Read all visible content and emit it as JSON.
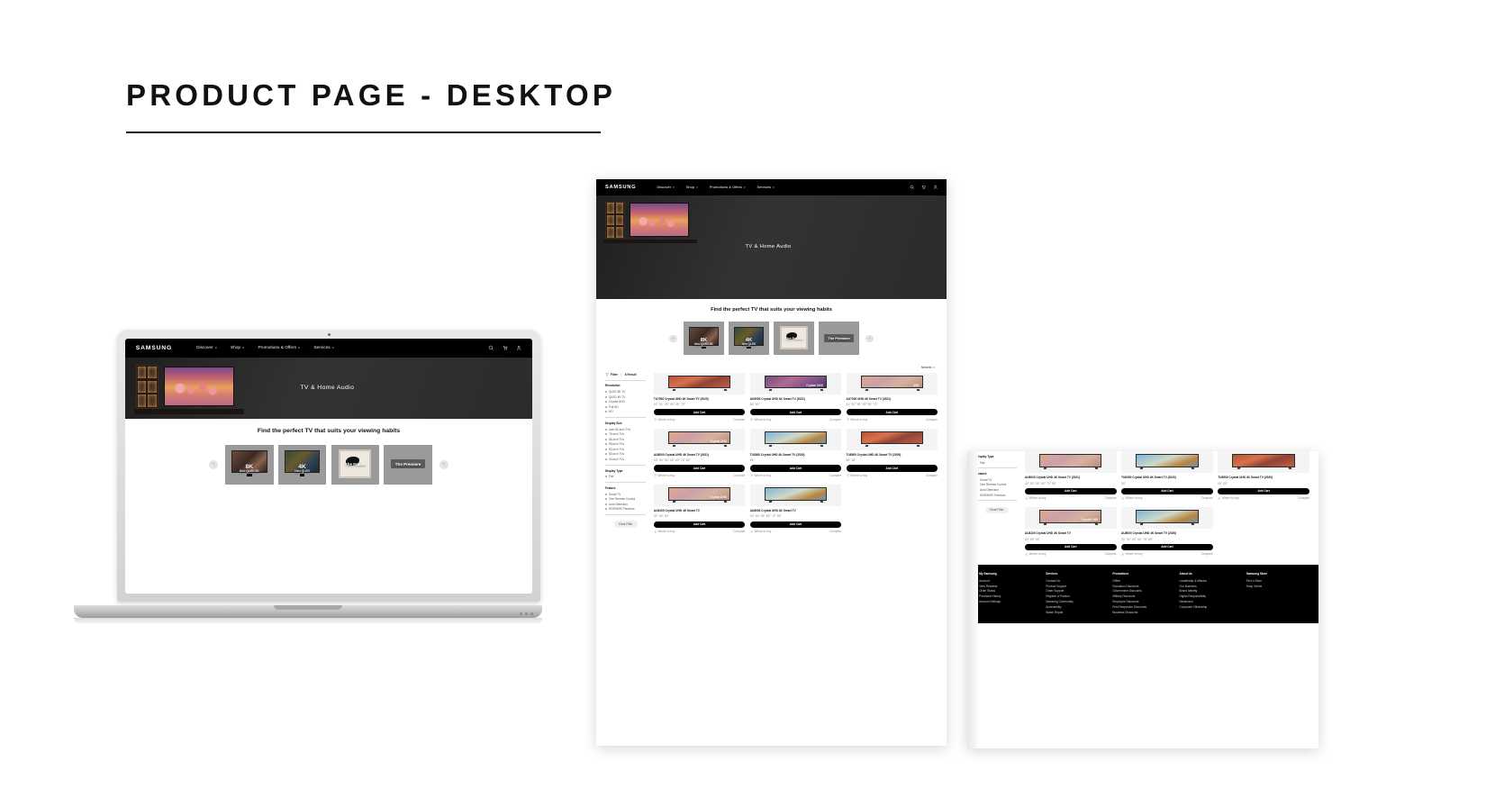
{
  "page": {
    "title": "PRODUCT PAGE - DESKTOP"
  },
  "brand": {
    "logo": "SAMSUNG"
  },
  "nav": {
    "items": [
      {
        "label": "Discover",
        "caret": "v"
      },
      {
        "label": "Shop",
        "caret": "v"
      },
      {
        "label": "Promotions & Offers",
        "caret": "v"
      },
      {
        "label": "Services",
        "caret": "v"
      }
    ],
    "icons": [
      {
        "name": "search-icon",
        "glyph": "search"
      },
      {
        "name": "cart-icon",
        "glyph": "cart"
      },
      {
        "name": "account-icon",
        "glyph": "person"
      }
    ]
  },
  "hero": {
    "title": "TV & Home Audio"
  },
  "finder": {
    "heading": "Find the perfect TV that suits your viewing habits",
    "prev_label": "‹",
    "next_label": "›",
    "tiles": [
      {
        "label": "8K",
        "sublabel": "Neo QLED 8K"
      },
      {
        "label": "4K",
        "sublabel": "Neo QLED"
      },
      {
        "label": "The Frame",
        "sublabel": ""
      },
      {
        "label": "The Premiere",
        "sublabel": ""
      }
    ]
  },
  "sort": {
    "label": "Newest",
    "caret": "v"
  },
  "filter": {
    "title": "Filter",
    "divider": "|",
    "result_count": "8 Result",
    "clear_label": "Clear Filter",
    "groups": [
      {
        "title": "Resolution",
        "options": [
          "QLED 8K TV",
          "QLED 4K TV",
          "Crystal UHD",
          "Full HD",
          "HD"
        ]
      },
      {
        "title": "Display Size",
        "options": [
          "over 82-inch TVs",
          "75-inch TVs",
          "65-inch TVs",
          "55-inch TVs",
          "50-inch TVs",
          "50-inch TVs",
          "43-inch TVs"
        ]
      },
      {
        "title": "Display Type",
        "options": [
          "Flat"
        ]
      },
      {
        "title": "Feature",
        "options": [
          "Smart TV",
          "One Remote Control",
          "Auto Detection",
          "HDR/HDR Premium"
        ]
      }
    ]
  },
  "product_labels": {
    "add_cart": "Add Cart",
    "where_to_buy": "Where to buy",
    "compare": "Compare"
  },
  "products_mid": [
    {
      "name": "TU7000 Crystal UHD 4K Smart TV (2020)",
      "sizes": "43\"  50\"  55\"  58\"  65\"  75\"",
      "badge": "",
      "tone": "warm"
    },
    {
      "name": "AU9000 Crystal UHD 4K Smart TV (2021)",
      "sizes": "55\"  65\"",
      "badge": "Crystal UHD",
      "tone": "violet"
    },
    {
      "name": "AU7000 UHD 4K Smart TV (2021)",
      "sizes": "43\"  50\"  55\"  58\"  65\"  70\"",
      "badge": "UHD",
      "tone": "peach"
    },
    {
      "name": "AU8000 Crystal UHD 4K Smart TV (2021)",
      "sizes": "43\"  50\"  55\"  60\"  65\"  75\"  85\"",
      "badge": "Crystal UHD",
      "tone": "peach"
    },
    {
      "name": "TU8300 Crystal UHD 4K Smart TV (2020)",
      "sizes": "55\"",
      "badge": "",
      "tone": "sky"
    },
    {
      "name": "TU8500 Crystal UHD 4K Smart TV (2020)",
      "sizes": "55\"  65\"",
      "badge": "",
      "tone": "warm"
    },
    {
      "name": "AU8100 Crystal UHD 4K Smart TV",
      "sizes": "50\"  55\"  65\"",
      "badge": "Crystal UHD",
      "tone": "peach"
    },
    {
      "name": "AU8000 Crystal UHD 4K Smart TV",
      "sizes": "43\"  50\"  55\"  65\"  75\"  85\"",
      "badge": "",
      "tone": "sky"
    }
  ],
  "products_right": [
    {
      "name": "AU8000 Crystal UHD 4K Smart TV (2021)",
      "sizes": "43\"  50\"  55\"  60\"  75\"  85\"",
      "badge": "",
      "tone": "peach"
    },
    {
      "name": "TU8300 Crystal UHD 4K Smart TV (2020)",
      "sizes": "55\"",
      "badge": "",
      "tone": "sky"
    },
    {
      "name": "TU8500 Crystal UHD 4K Smart TV (2020)",
      "sizes": "55\"  65\"",
      "badge": "",
      "tone": "warm"
    },
    {
      "name": "AU8100 Crystal UHD 4K Smart TV",
      "sizes": "50\"  55\"  65\"",
      "badge": "Crystal UHD",
      "tone": "peach"
    },
    {
      "name": "AU8000 Crystal UHD 4K Smart TV (2020)",
      "sizes": "43\"  50\"  55\"  65\"  75\"  85\"",
      "badge": "",
      "tone": "sky"
    }
  ],
  "footer": {
    "columns": [
      {
        "title": "My Samsung",
        "items": [
          "Account",
          "View Rewards",
          "Order Status",
          "Purchase History",
          "Account Settings"
        ]
      },
      {
        "title": "Services",
        "items": [
          "Contact Us",
          "Product Support",
          "Order Support",
          "Register a Product",
          "Samsung Community",
          "Accessibility",
          "Watch Repair"
        ]
      },
      {
        "title": "Promotions",
        "items": [
          "Offers",
          "Education Discounts",
          "Government Discounts",
          "Military Discounts",
          "Employee Discounts",
          "First Responder Discounts",
          "Business Discounts"
        ]
      },
      {
        "title": "About Us",
        "items": [
          "Leadership & Mission",
          "Our Business",
          "Brand Identity",
          "Digital Responsibility",
          "Newsroom",
          "Corporate Citizenship"
        ]
      },
      {
        "title": "Samsung Store",
        "items": [
          "Find a Store",
          "Shop Online"
        ]
      }
    ]
  }
}
